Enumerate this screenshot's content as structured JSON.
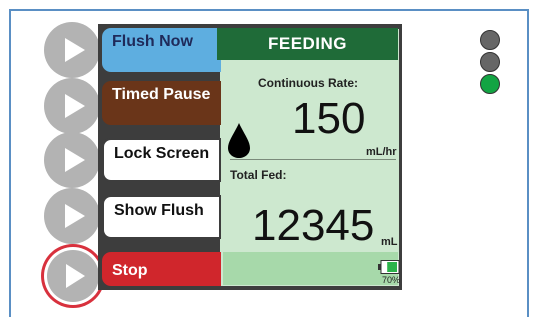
{
  "softkeys": {
    "flush_now": "Flush Now",
    "timed_pause": "Timed Pause",
    "lock_screen": "Lock Screen",
    "show_flush": "Show Flush",
    "stop": "Stop"
  },
  "status": {
    "title": "FEEDING"
  },
  "rate": {
    "label": "Continuous Rate:",
    "value": "150",
    "unit": "mL/hr"
  },
  "total": {
    "label": "Total Fed:",
    "value": "12345",
    "unit": "mL"
  },
  "battery": {
    "percent": "70%",
    "level": 0.7,
    "color": "#2bb34a"
  },
  "indicators": [
    {
      "name": "indicator-1",
      "color": "#666666"
    },
    {
      "name": "indicator-2",
      "color": "#666666"
    },
    {
      "name": "indicator-3",
      "color": "#12a443"
    }
  ],
  "colors": {
    "flush_now": "#5eaee0",
    "timed_pause": "#6a3519",
    "stop": "#d0262c",
    "feeding_bar": "#1f6b38",
    "screen_bg": "#cde8cf"
  }
}
